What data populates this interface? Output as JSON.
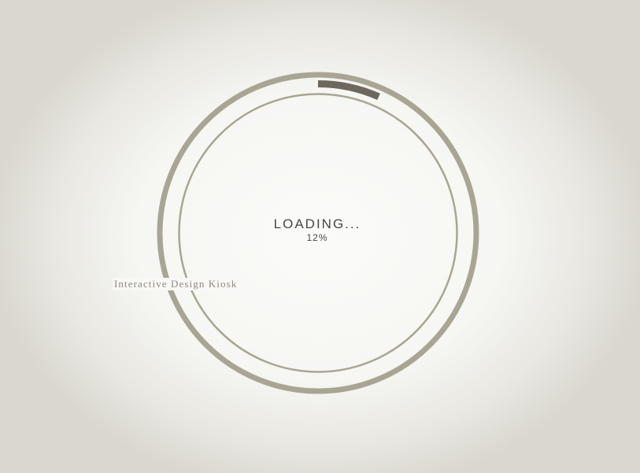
{
  "loading": {
    "label": "LOADING...",
    "percent_text": "12%",
    "progress": 0.12
  },
  "kiosk": {
    "label": "Interactive Design Kiosk"
  },
  "colors": {
    "ring": "#a9a594",
    "inner_ring": "#a9a594",
    "progress_arc": "#6e675d",
    "text": "#4a4742",
    "label": "#8e8a7d"
  }
}
